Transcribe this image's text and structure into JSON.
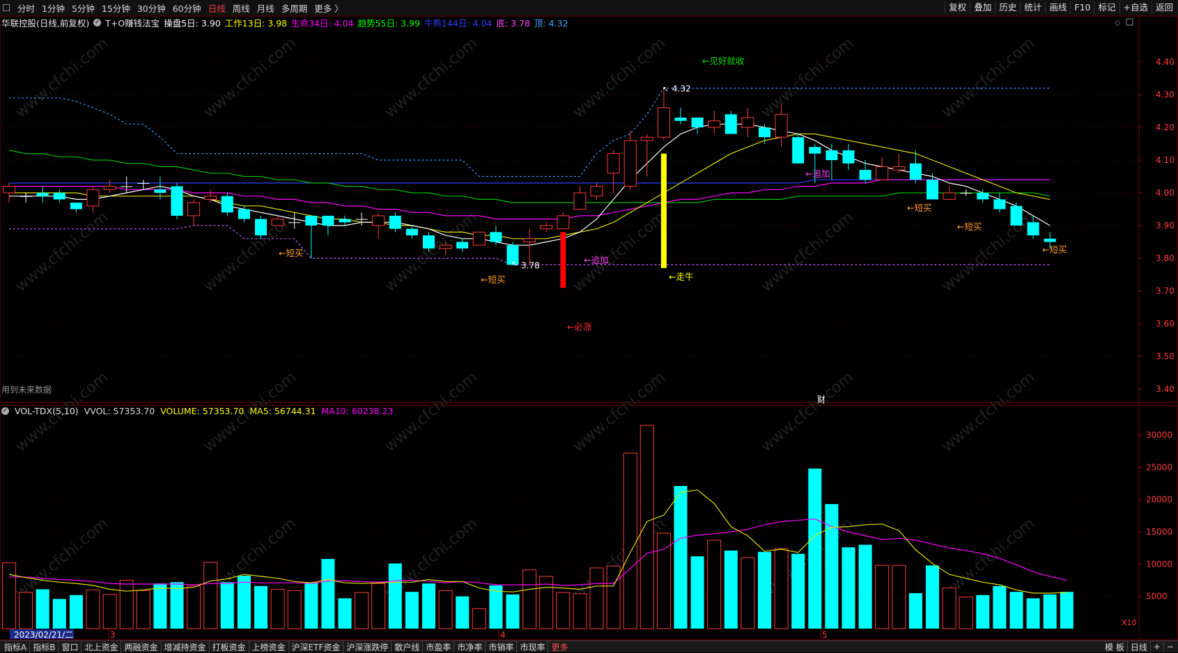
{
  "toolbar": {
    "periods": [
      "分时",
      "1分钟",
      "5分钟",
      "15分钟",
      "30分钟",
      "60分钟",
      "日线",
      "周线",
      "月线",
      "多周期",
      "更多 〉"
    ],
    "active_period": "日线",
    "right": [
      "复权",
      "叠加",
      "历史",
      "统计",
      "画线",
      "F10",
      "标记",
      "+自选",
      "返回"
    ]
  },
  "info": {
    "stock": "华联控股(日线,前复权)",
    "formula": "T+O赚钱法宝",
    "items": [
      {
        "text": "操盘5日: 3.90",
        "color": "#ffffff"
      },
      {
        "text": "工作13日: 3.98",
        "color": "#ffff00"
      },
      {
        "text": "生命34日: 4.04",
        "color": "#ff00ff"
      },
      {
        "text": "趋势55日: 3.99",
        "color": "#00ff00"
      },
      {
        "text": "牛熊144日: 4.04",
        "color": "#2f3fff"
      },
      {
        "text": "底: 3.78",
        "color": "#ff44ff"
      },
      {
        "text": "顶: 4.32",
        "color": "#3fa9ff"
      }
    ]
  },
  "vol_info": {
    "name": "VOL-TDX(5,10)",
    "items": [
      {
        "text": "VVOL: 57353.70",
        "color": "#dddddd"
      },
      {
        "text": "VOLUME: 57353.70",
        "color": "#ffff00"
      },
      {
        "text": "MA5: 56744.31",
        "color": "#ffff00"
      },
      {
        "text": "MA10: 60238.23",
        "color": "#ff00ff"
      }
    ]
  },
  "note": "用到未来数据",
  "price_axis": [
    "4.40",
    "4.30",
    "4.20",
    "4.10",
    "4.00",
    "3.90",
    "3.80",
    "3.70",
    "3.60",
    "3.50",
    "3.40"
  ],
  "vol_axis": [
    "30000",
    "25000",
    "20000",
    "15000",
    "10000",
    "5000"
  ],
  "vol_unit": "X10",
  "date_label": "2023/02/21/二",
  "month_marks": [
    "3",
    "4",
    "5"
  ],
  "fin_marker": "财",
  "watermark": "www.cfchi.com",
  "signals": [
    {
      "text": "←见好就收",
      "color": "#00e000",
      "bar": 40
    },
    {
      "text": "←短买",
      "color": "#ff9a2e",
      "bar": 16
    },
    {
      "text": "←短买",
      "color": "#ff9a2e",
      "bar": 28
    },
    {
      "text": "←追加",
      "color": "#ff44ff",
      "bar": 33
    },
    {
      "text": "←必涨",
      "color": "#ff2a2a",
      "bar": 33
    },
    {
      "text": "←走牛",
      "color": "#ffff00",
      "bar": 39
    },
    {
      "text": "←追加",
      "color": "#ff44ff",
      "bar": 47
    },
    {
      "text": "←短买",
      "color": "#ff9a2e",
      "bar": 53
    },
    {
      "text": "←短买",
      "color": "#ff9a2e",
      "bar": 56
    },
    {
      "text": "←短买",
      "color": "#ff9a2e",
      "bar": 61
    }
  ],
  "high_label": "4.32",
  "low_label": "3.78",
  "chart_data": {
    "type": "candlestick",
    "candles": [
      [
        4.0,
        4.02,
        3.97,
        4.03
      ],
      [
        3.99,
        3.99,
        3.97,
        4.0
      ],
      [
        4.0,
        3.99,
        3.97,
        4.02
      ],
      [
        4.0,
        3.98,
        3.97,
        4.01
      ],
      [
        3.97,
        3.95,
        3.94,
        3.97
      ],
      [
        3.96,
        4.01,
        3.94,
        4.02
      ],
      [
        4.01,
        4.02,
        4.0,
        4.04
      ],
      [
        4.02,
        4.02,
        4.0,
        4.05
      ],
      [
        4.03,
        4.03,
        4.01,
        4.04
      ],
      [
        4.01,
        4.0,
        3.98,
        4.05
      ],
      [
        4.02,
        3.93,
        3.92,
        4.03
      ],
      [
        3.93,
        3.97,
        3.9,
        3.98
      ],
      [
        3.98,
        3.99,
        3.97,
        4.01
      ],
      [
        3.99,
        3.94,
        3.93,
        4.0
      ],
      [
        3.95,
        3.92,
        3.91,
        3.96
      ],
      [
        3.92,
        3.87,
        3.86,
        3.93
      ],
      [
        3.9,
        3.92,
        3.9,
        3.93
      ],
      [
        3.91,
        3.91,
        3.89,
        3.94
      ],
      [
        3.93,
        3.9,
        3.8,
        3.93
      ],
      [
        3.93,
        3.9,
        3.87,
        3.93
      ],
      [
        3.92,
        3.91,
        3.9,
        3.93
      ],
      [
        3.92,
        3.92,
        3.9,
        3.94
      ],
      [
        3.9,
        3.93,
        3.86,
        3.94
      ],
      [
        3.93,
        3.89,
        3.88,
        3.94
      ],
      [
        3.89,
        3.87,
        3.86,
        3.9
      ],
      [
        3.87,
        3.83,
        3.82,
        3.88
      ],
      [
        3.83,
        3.84,
        3.81,
        3.85
      ],
      [
        3.85,
        3.83,
        3.82,
        3.86
      ],
      [
        3.84,
        3.88,
        3.84,
        3.88
      ],
      [
        3.88,
        3.85,
        3.84,
        3.9
      ],
      [
        3.84,
        3.78,
        3.78,
        3.85
      ],
      [
        3.85,
        3.86,
        3.78,
        3.89
      ],
      [
        3.89,
        3.9,
        3.88,
        3.91
      ],
      [
        3.89,
        3.93,
        3.89,
        3.94
      ],
      [
        3.95,
        4.0,
        3.95,
        4.02
      ],
      [
        3.99,
        4.02,
        3.98,
        4.03
      ],
      [
        4.06,
        4.12,
        4.0,
        4.13
      ],
      [
        4.02,
        4.16,
        4.01,
        4.19
      ],
      [
        4.16,
        4.17,
        4.05,
        4.18
      ],
      [
        4.17,
        4.26,
        4.16,
        4.32
      ],
      [
        4.23,
        4.22,
        4.21,
        4.26
      ],
      [
        4.23,
        4.2,
        4.18,
        4.23
      ],
      [
        4.2,
        4.22,
        4.18,
        4.25
      ],
      [
        4.24,
        4.18,
        4.18,
        4.25
      ],
      [
        4.2,
        4.23,
        4.17,
        4.26
      ],
      [
        4.2,
        4.17,
        4.15,
        4.21
      ],
      [
        4.17,
        4.24,
        4.14,
        4.27
      ],
      [
        4.17,
        4.09,
        4.09,
        4.18
      ],
      [
        4.14,
        4.12,
        4.03,
        4.15
      ],
      [
        4.13,
        4.1,
        4.04,
        4.15
      ],
      [
        4.13,
        4.09,
        4.07,
        4.15
      ],
      [
        4.07,
        4.04,
        4.03,
        4.1
      ],
      [
        4.04,
        4.08,
        4.04,
        4.11
      ],
      [
        4.07,
        4.08,
        4.06,
        4.12
      ],
      [
        4.09,
        4.04,
        4.03,
        4.13
      ],
      [
        4.04,
        3.98,
        3.98,
        4.06
      ],
      [
        3.98,
        4.0,
        3.98,
        4.02
      ],
      [
        4.0,
        4.0,
        3.99,
        4.01
      ],
      [
        4.0,
        3.98,
        3.97,
        4.01
      ],
      [
        3.98,
        3.95,
        3.94,
        4.0
      ],
      [
        3.96,
        3.9,
        3.9,
        3.97
      ],
      [
        3.91,
        3.87,
        3.86,
        3.93
      ],
      [
        3.86,
        3.85,
        3.83,
        3.88
      ]
    ],
    "ma5": [
      3.99,
      3.99,
      3.99,
      3.99,
      3.98,
      3.98,
      3.99,
      4.0,
      4.01,
      4.02,
      4.01,
      3.99,
      3.98,
      3.96,
      3.95,
      3.94,
      3.93,
      3.92,
      3.91,
      3.9,
      3.9,
      3.91,
      3.91,
      3.91,
      3.9,
      3.89,
      3.87,
      3.86,
      3.86,
      3.85,
      3.84,
      3.84,
      3.85,
      3.86,
      3.88,
      3.92,
      3.98,
      4.04,
      4.09,
      4.14,
      4.18,
      4.2,
      4.21,
      4.21,
      4.21,
      4.2,
      4.19,
      4.18,
      4.16,
      4.13,
      4.11,
      4.09,
      4.08,
      4.07,
      4.06,
      4.05,
      4.03,
      4.02,
      4.0,
      3.98,
      3.96,
      3.93,
      3.9
    ],
    "ma13": [
      4.0,
      4.0,
      4.0,
      4.0,
      4.0,
      3.99,
      3.99,
      3.99,
      3.99,
      3.99,
      3.99,
      3.99,
      3.98,
      3.97,
      3.96,
      3.96,
      3.95,
      3.94,
      3.93,
      3.92,
      3.92,
      3.91,
      3.91,
      3.9,
      3.9,
      3.89,
      3.88,
      3.88,
      3.87,
      3.87,
      3.86,
      3.86,
      3.86,
      3.87,
      3.88,
      3.89,
      3.91,
      3.94,
      3.97,
      4.0,
      4.03,
      4.06,
      4.09,
      4.12,
      4.14,
      4.16,
      4.17,
      4.18,
      4.18,
      4.17,
      4.16,
      4.15,
      4.14,
      4.13,
      4.12,
      4.1,
      4.08,
      4.06,
      4.04,
      4.02,
      4.0,
      3.99,
      3.98
    ],
    "ma34": [
      4.02,
      4.02,
      4.02,
      4.02,
      4.02,
      4.02,
      4.02,
      4.01,
      4.01,
      4.01,
      4.01,
      4.0,
      4.0,
      4.0,
      3.99,
      3.99,
      3.98,
      3.98,
      3.97,
      3.97,
      3.96,
      3.96,
      3.95,
      3.95,
      3.94,
      3.94,
      3.93,
      3.93,
      3.93,
      3.92,
      3.92,
      3.92,
      3.92,
      3.92,
      3.93,
      3.93,
      3.94,
      3.95,
      3.96,
      3.97,
      3.98,
      3.98,
      3.99,
      4.0,
      4.0,
      4.01,
      4.01,
      4.02,
      4.02,
      4.03,
      4.03,
      4.03,
      4.04,
      4.04,
      4.04,
      4.04,
      4.04,
      4.04,
      4.04,
      4.04,
      4.04,
      4.04,
      4.04
    ],
    "ma55": [
      4.13,
      4.12,
      4.12,
      4.11,
      4.11,
      4.1,
      4.1,
      4.09,
      4.09,
      4.08,
      4.08,
      4.07,
      4.06,
      4.06,
      4.05,
      4.05,
      4.04,
      4.04,
      4.03,
      4.03,
      4.02,
      4.02,
      4.01,
      4.01,
      4.0,
      4.0,
      3.99,
      3.99,
      3.98,
      3.98,
      3.97,
      3.97,
      3.97,
      3.97,
      3.97,
      3.97,
      3.97,
      3.97,
      3.97,
      3.97,
      3.97,
      3.97,
      3.98,
      3.98,
      3.98,
      3.98,
      3.98,
      3.99,
      3.99,
      3.99,
      3.99,
      3.99,
      3.99,
      4.0,
      4.0,
      4.0,
      4.0,
      4.0,
      4.0,
      4.0,
      4.0,
      4.0,
      3.99
    ],
    "ma144": [
      4.03,
      4.03,
      4.03,
      4.03,
      4.03,
      4.03,
      4.03,
      4.03,
      4.03,
      4.03,
      4.03,
      4.03,
      4.03,
      4.03,
      4.03,
      4.03,
      4.03,
      4.03,
      4.03,
      4.03,
      4.03,
      4.03,
      4.03,
      4.03,
      4.03,
      4.03,
      4.03,
      4.03,
      4.03,
      4.03,
      4.03,
      4.03,
      4.03,
      4.03,
      4.03,
      4.03,
      4.03,
      4.03,
      4.03,
      4.03,
      4.03,
      4.03,
      4.03,
      4.03,
      4.03,
      4.03,
      4.03,
      4.03,
      4.04,
      4.04,
      4.04,
      4.04,
      4.04,
      4.04,
      4.04,
      4.04,
      4.04,
      4.04,
      4.04,
      4.04,
      4.04,
      4.04,
      4.04
    ],
    "top_line": [
      4.29,
      4.29,
      4.29,
      4.29,
      4.28,
      4.26,
      4.24,
      4.21,
      4.21,
      4.17,
      4.12,
      4.12,
      4.12,
      4.12,
      4.12,
      4.12,
      4.12,
      4.12,
      4.12,
      4.12,
      4.12,
      4.12,
      4.1,
      4.1,
      4.1,
      4.1,
      4.1,
      4.1,
      4.05,
      4.05,
      4.05,
      4.05,
      4.05,
      4.05,
      4.05,
      4.12,
      4.16,
      4.18,
      4.24,
      4.32,
      4.32,
      4.32,
      4.32,
      4.32,
      4.32,
      4.32,
      4.32,
      4.32,
      4.32,
      4.32,
      4.32,
      4.32,
      4.32,
      4.32,
      4.32,
      4.32,
      4.32,
      4.32,
      4.32,
      4.32,
      4.32,
      4.32,
      4.32
    ],
    "bottom_line": [
      3.89,
      3.89,
      3.89,
      3.89,
      3.89,
      3.89,
      3.89,
      3.89,
      3.89,
      3.89,
      3.89,
      3.9,
      3.9,
      3.9,
      3.86,
      3.86,
      3.86,
      3.86,
      3.8,
      3.8,
      3.8,
      3.8,
      3.8,
      3.8,
      3.8,
      3.8,
      3.8,
      3.8,
      3.8,
      3.8,
      3.78,
      3.78,
      3.78,
      3.78,
      3.78,
      3.78,
      3.78,
      3.78,
      3.78,
      3.78,
      3.78,
      3.78,
      3.78,
      3.78,
      3.78,
      3.78,
      3.78,
      3.78,
      3.78,
      3.78,
      3.78,
      3.78,
      3.78,
      3.78,
      3.78,
      3.78,
      3.78,
      3.78,
      3.78,
      3.78,
      3.78,
      3.78,
      3.78
    ],
    "signal_bars": [
      {
        "bar": 33,
        "from": 3.71,
        "to": 3.88,
        "color": "#ff0000"
      },
      {
        "bar": 39,
        "from": 3.77,
        "to": 4.12,
        "color": "#ffff00"
      }
    ],
    "volume": [
      10200,
      5600,
      6100,
      4600,
      5200,
      6000,
      5300,
      7500,
      5900,
      7000,
      7200,
      6600,
      10300,
      7200,
      8200,
      6600,
      6100,
      5900,
      7200,
      10800,
      4700,
      5600,
      7000,
      10100,
      5700,
      7000,
      5900,
      5000,
      3100,
      6700,
      5300,
      9100,
      8100,
      5600,
      5400,
      9400,
      9700,
      27200,
      31500,
      14800,
      22100,
      11200,
      13700,
      12100,
      11000,
      11900,
      12400,
      11600,
      24800,
      19300,
      12600,
      13000,
      9800,
      9800,
      5500,
      9800,
      6300,
      4900,
      5200,
      6600,
      5700,
      4700,
      5300,
      5700
    ],
    "vol_ma5": [
      8400,
      7900,
      7500,
      7200,
      7000,
      6700,
      6100,
      5800,
      6000,
      6300,
      6200,
      6400,
      7400,
      7700,
      8400,
      8100,
      7800,
      7300,
      7100,
      7600,
      7100,
      7000,
      7100,
      7200,
      7200,
      7600,
      7300,
      7300,
      6300,
      5800,
      5700,
      6100,
      6400,
      6300,
      6100,
      6600,
      6600,
      11800,
      16600,
      17600,
      21100,
      21500,
      19400,
      15800,
      14400,
      12000,
      12300,
      11800,
      14400,
      15700,
      15800,
      16100,
      16200,
      15200,
      12200,
      10100,
      8400,
      7800,
      7200,
      6800,
      6000,
      5500,
      5500,
      5600
    ],
    "vol_ma10": [
      8000,
      8000,
      7800,
      7600,
      7500,
      7300,
      7000,
      6900,
      6900,
      6900,
      6900,
      6800,
      7000,
      7000,
      7200,
      7100,
      7100,
      7100,
      7000,
      7400,
      7400,
      7300,
      7200,
      7400,
      7500,
      7300,
      7100,
      7300,
      7100,
      6800,
      6800,
      6800,
      6900,
      6700,
      6800,
      7000,
      7000,
      9300,
      11700,
      12300,
      14000,
      14500,
      14700,
      15000,
      15400,
      16100,
      16600,
      16800,
      17000,
      15800,
      15000,
      14400,
      13800,
      14000,
      13700,
      13100,
      12500,
      12100,
      11600,
      10900,
      9900,
      8800,
      8100,
      7500
    ]
  }
}
